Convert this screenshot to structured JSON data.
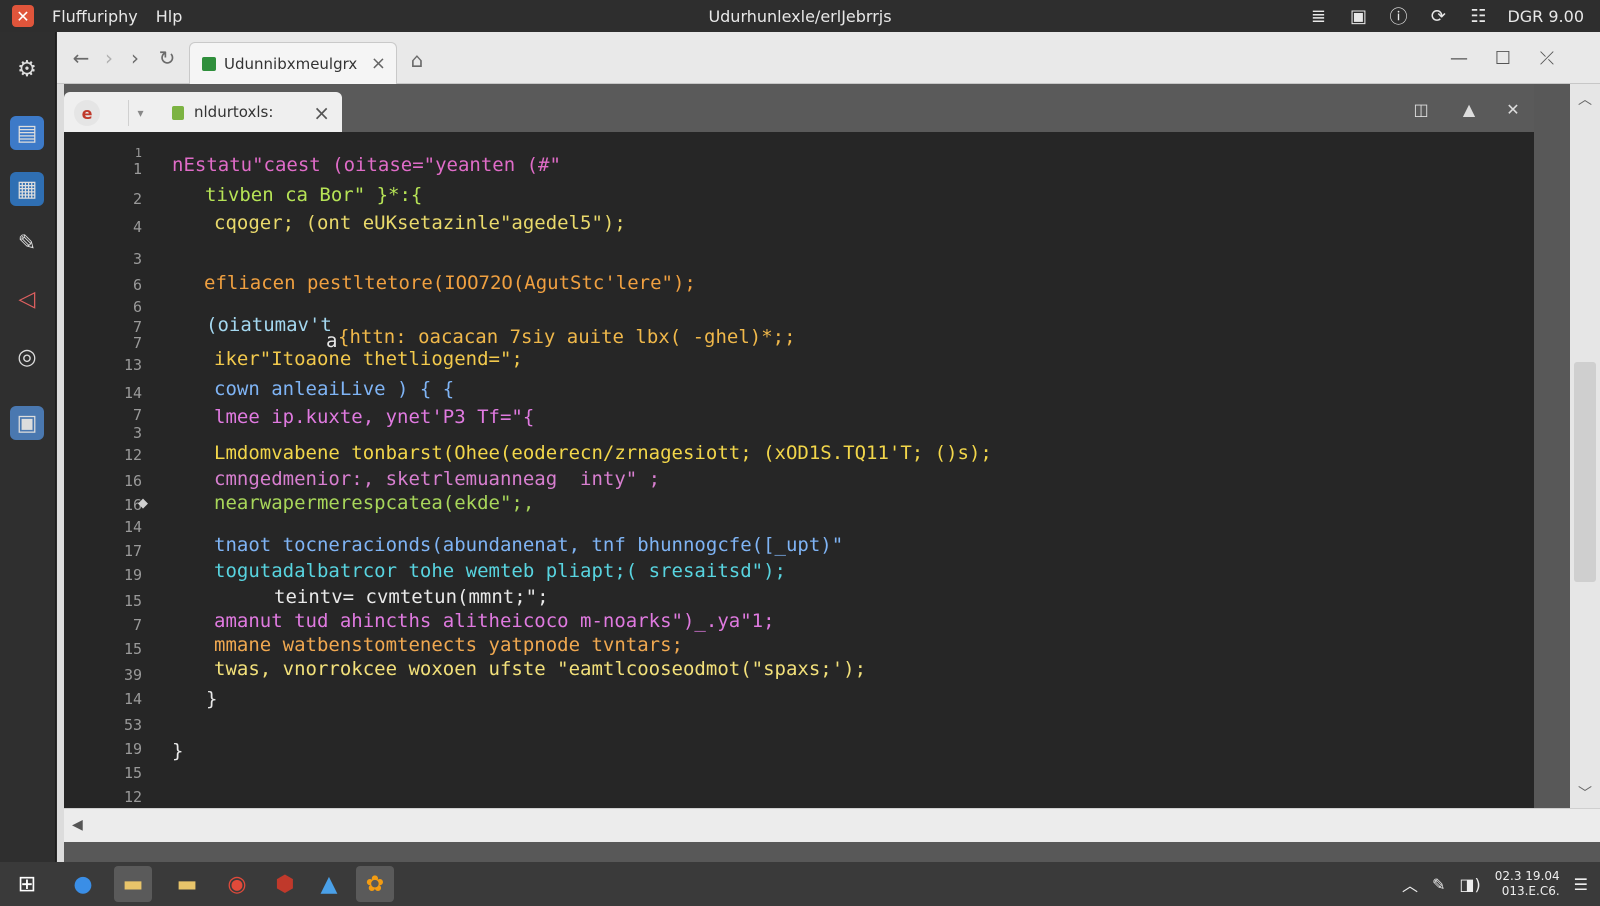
{
  "menubar": {
    "app_name": "Fluffuriphy",
    "help_menu": "Hlp",
    "window_title": "Udurhunlexle/erlJebrrjs",
    "status_text": "DGR 9.00"
  },
  "dock": {
    "items": [
      "gear-icon",
      "files-icon",
      "folder-icon",
      "brush-icon",
      "vector-icon",
      "camera-icon",
      "monitor-icon"
    ]
  },
  "browser": {
    "tab_title": "Udunnibxmeulgrx"
  },
  "editor": {
    "tab_title": "nldurtoxls:",
    "line_numbers": [
      "1",
      "1",
      "2",
      "4",
      "3",
      "6",
      "6",
      "7",
      "7",
      "13",
      "14",
      "7",
      "3",
      "12",
      "16",
      "16",
      "14",
      "17",
      "19",
      "15",
      "7",
      "15",
      "39",
      "14",
      "53",
      "19",
      "15",
      "12"
    ],
    "lines": [
      {
        "text": "nEstatu\"caest (oitase=\"yeanten (#\"",
        "color": "#e06cc8"
      },
      {
        "text": "tivben ca Bor\" }*:{",
        "color": "#b6e356"
      },
      {
        "text": "cqoger; (ont eUKsetazinle\"agedel5\");",
        "color": "#e9d96b"
      },
      {
        "text": "efliacen pestltetore(IOO72O(AgutStc'lere\");",
        "color": "#f0a040"
      },
      {
        "text": "(oiatumav't",
        "color": "#a4d8f0"
      },
      {
        "text": "a",
        "color": "#e8e8e8"
      },
      {
        "text": "{httn: oacacan 7siy auite lbx( -ghel)*;;",
        "color": "#f0b84a"
      },
      {
        "text": "iker\"Itoaone thetliogend=\";",
        "color": "#f2c94c"
      },
      {
        "text": "cown anleaiLive ) { {",
        "color": "#7fb4f5"
      },
      {
        "text": "lmee ip.kuxte, ynet'P3 Tf=\"{",
        "color": "#e07ae0"
      },
      {
        "text": "Lmdomvabene tonbarst(Ohee(eoderecn/zrnagesiott; (xOD1S.TQ11'T; ()s);",
        "color": "#f2d64a"
      },
      {
        "text": "cmngedmenior:, sketrlemuanneag  inty\" ;",
        "color": "#d87fd0"
      },
      {
        "text": "nearwapermerespcatea(ekde\";,",
        "color": "#a8d65a"
      },
      {
        "text": "tnaot tocneracionds(abundanenat, tnf bhunnogcfe([_upt)\"",
        "color": "#7fb4f5"
      },
      {
        "text": "togutadalbatrcor tohe wemteb pliapt;( sresaitsd\");",
        "color": "#58d4e0"
      },
      {
        "text": "teintv= cvmtetun(mmnt;\";",
        "color": "#e9e9e9"
      },
      {
        "text": "amanut tud ahincths alitheicoco m-noarks\")_.ya\"1;",
        "color": "#e07ae0"
      },
      {
        "text": "mmane watbenstomtenects yatpnode tvntars;",
        "color": "#f0a850"
      },
      {
        "text": "twas, vnorrokcee woxoen ufste \"eamtlcooseodmot(\"spaxs;');",
        "color": "#f2e07a"
      },
      {
        "text": "}",
        "color": "#e8e8e8"
      },
      {
        "text": "}",
        "color": "#e8e8e8"
      }
    ]
  },
  "taskbar": {
    "clock_time": "02.3 19.04",
    "clock_date": "013.E.C6."
  }
}
